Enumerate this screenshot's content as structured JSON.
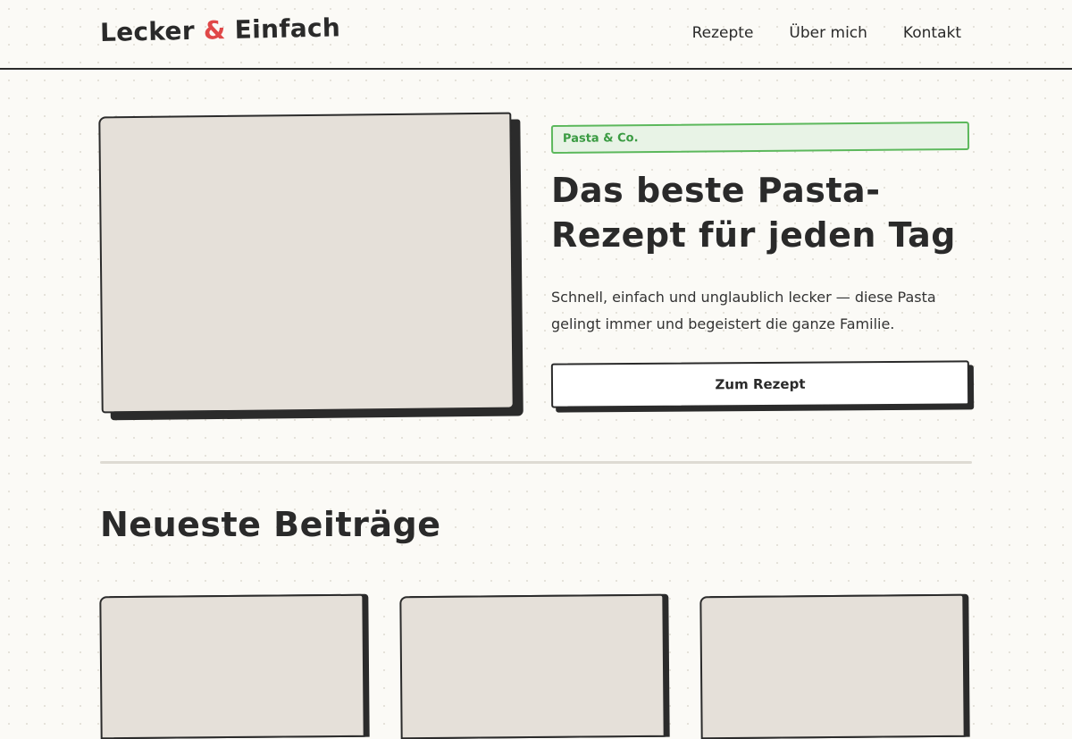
{
  "header": {
    "logo_part1": "Lecker",
    "logo_amp": "&",
    "logo_part2": "Einfach",
    "nav": [
      {
        "label": "Rezepte"
      },
      {
        "label": "Über mich"
      },
      {
        "label": "Kontakt"
      }
    ]
  },
  "hero": {
    "category": "Pasta & Co.",
    "title": "Das beste Pasta-Rezept für jeden Tag",
    "description": "Schnell, einfach und unglaublich lecker — diese Pasta gelingt immer und begeistert die ganze Familie.",
    "cta_label": "Zum Rezept"
  },
  "latest": {
    "title": "Neueste Beiträge"
  },
  "colors": {
    "accent_red": "#e04848",
    "badge_green": "#3a9b42",
    "ink": "#2b2b2b",
    "paper": "#fbfaf6",
    "placeholder": "#e5e0d9"
  }
}
